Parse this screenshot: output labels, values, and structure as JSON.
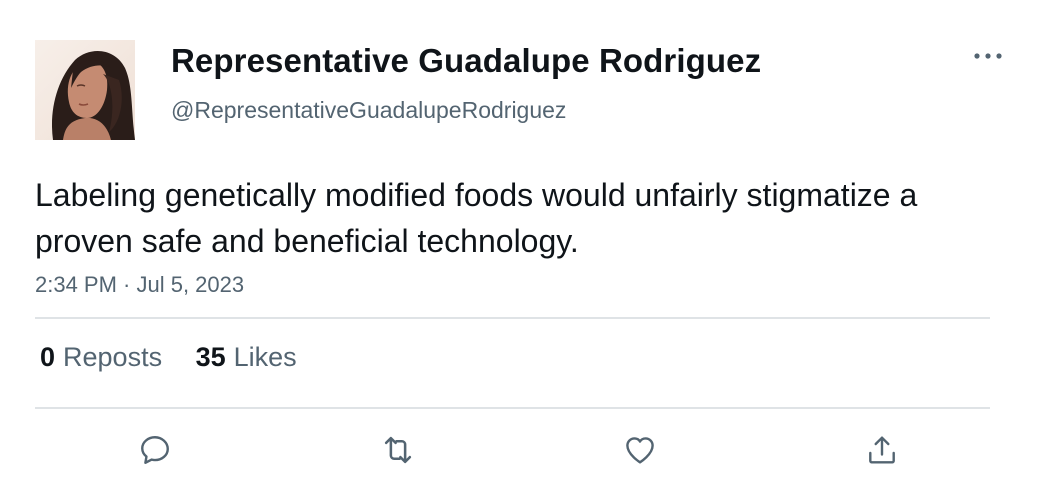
{
  "author": {
    "display_name": "Representative Guadalupe Rodriguez",
    "handle": "@RepresentativeGuadalupeRodriguez",
    "avatar": "profile-photo-woman-long-dark-hair"
  },
  "tweet": {
    "text": "Labeling genetically modified foods would unfairly stigmatize a proven safe and beneficial technology.",
    "timestamp": "2:34 PM · Jul 5, 2023"
  },
  "stats": {
    "reposts_count": "0",
    "reposts_label": "Reposts",
    "likes_count": "35",
    "likes_label": "Likes"
  },
  "actions": {
    "reply_icon": "speech-bubble-icon",
    "repost_icon": "repost-arrows-icon",
    "like_icon": "heart-icon",
    "share_icon": "share-upload-icon"
  },
  "colors": {
    "text_primary": "#0f1419",
    "text_secondary": "#536471",
    "divider": "#dfe3e6"
  }
}
